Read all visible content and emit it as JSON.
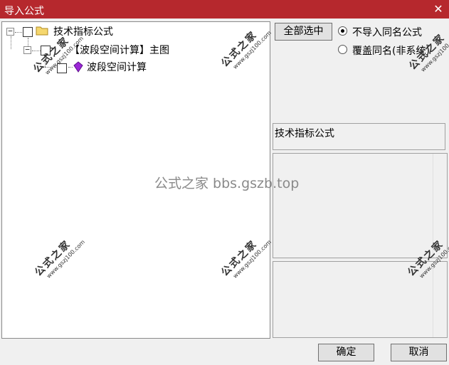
{
  "window": {
    "title": "导入公式",
    "close_glyph": "✕"
  },
  "tree": {
    "root": {
      "label": "技术指标公式",
      "expander": "−",
      "icon": "folder-icon"
    },
    "child": {
      "label": "【波段空间计算】主图",
      "expander": "−"
    },
    "leaf": {
      "label": "波段空间计算",
      "icon": "formula-icon"
    }
  },
  "controls": {
    "select_all_label": "全部选中",
    "radio_options": [
      {
        "label": "不导入同名公式",
        "checked": true
      },
      {
        "label": "覆盖同名(非系统)",
        "checked": false
      }
    ]
  },
  "details": {
    "name": "技术指标公式"
  },
  "footer": {
    "ok_label": "确定",
    "cancel_label": "取消"
  },
  "watermark": {
    "center_text": "公式之家 bbs.gszb.top",
    "stamp_big": "公式之家",
    "stamp_small": "www.gszj100.com"
  }
}
